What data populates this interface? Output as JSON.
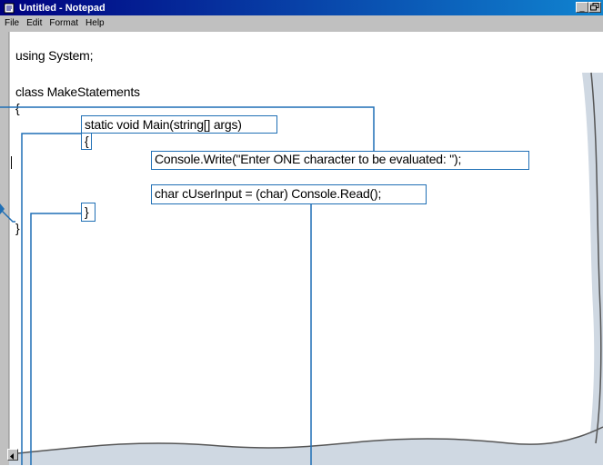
{
  "window": {
    "title": "Untitled - Notepad",
    "controls": {
      "minimize": "_",
      "restore": "8"
    }
  },
  "menu": [
    "File",
    "Edit",
    "Format",
    "Help"
  ],
  "editor": {
    "lines": [
      "using System;",
      "class MakeStatements",
      "{",
      "static void Main(string[] args)",
      "{",
      "Console.Write(\"Enter ONE character to be evaluated: \");",
      "char cUserInput = (char) Console.Read();",
      "}",
      "}"
    ]
  },
  "colors": {
    "title_bar": "#000080",
    "callout": "#1f6fb5",
    "page_curl_shadow": "#cfd8e2"
  },
  "icons": [
    "notepad-icon",
    "minimize-icon",
    "restore-icon",
    "scroll-left-icon"
  ]
}
